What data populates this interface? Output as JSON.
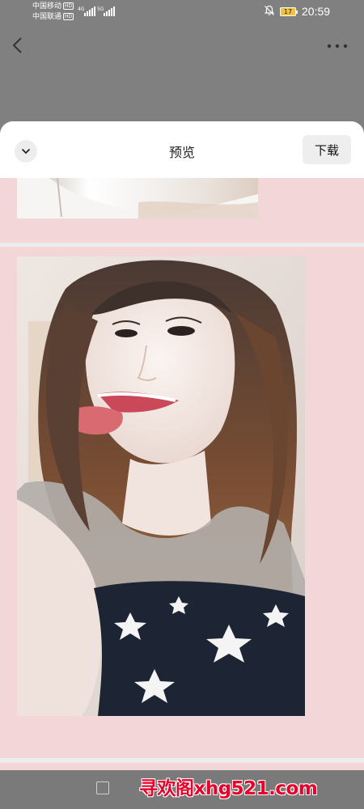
{
  "status_bar": {
    "carrier_1": "中国移动",
    "carrier_2": "中国联通",
    "hd_badge": "HD",
    "network_1": "4G",
    "network_2": "5G",
    "battery_level": "17",
    "time": "20:59",
    "notification_icon": "bell-muted-icon"
  },
  "nav": {
    "back_icon": "chevron-left-icon",
    "more_icon": "more-dots-icon"
  },
  "sheet": {
    "title": "预览",
    "download_label": "下载",
    "collapse_icon": "chevron-down-icon",
    "background_color": "#f3d6d7"
  },
  "bottom_bar": {
    "checkbox_icon": "checkbox-icon",
    "watermark": "寻欢阁xhg521.com"
  }
}
